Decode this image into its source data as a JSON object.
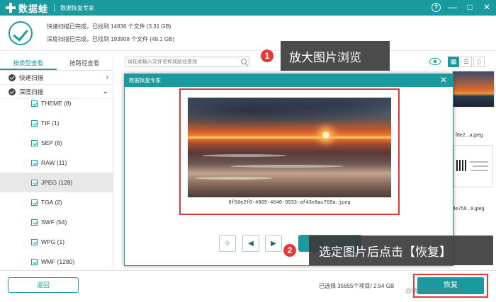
{
  "titlebar": {
    "app_name": "数据蛙",
    "subtitle": "数据恢复专家",
    "help": "?",
    "minimize": "—",
    "maximize": "□",
    "close": "✕"
  },
  "status": {
    "quick_scan": "快速扫描已完成，已找到   14836 个文件 (3.31 GB)",
    "deep_scan": "深度扫描已完成，已找到   193908 个文件 (49.1 GB)"
  },
  "left_panel": {
    "tabs": [
      "按类型查看",
      "按路径查看"
    ],
    "quick_scan_label": "快速扫描",
    "deep_scan_label": "深度扫描",
    "file_types": [
      {
        "label": "THEME (8)"
      },
      {
        "label": "TIF (1)"
      },
      {
        "label": "SEP (8)"
      },
      {
        "label": "RAW (11)"
      },
      {
        "label": "JPEG (128)",
        "selected": true
      },
      {
        "label": "TGA (2)"
      },
      {
        "label": "SWF (54)"
      },
      {
        "label": "WPG (1)"
      },
      {
        "label": "WMF (1280)"
      }
    ]
  },
  "toolbar": {
    "search_placeholder": "请在此输入文件名称或路径查找"
  },
  "background": {
    "thumb1_caption": "f8e2...a.jpeg",
    "thumb2_caption": "4e759...9.jpeg"
  },
  "dialog": {
    "title": "数据恢复专家",
    "close": "✕",
    "image_filename": "0f56e2f0-4909-4640-9933-af43e8ac769a.jpeg",
    "btn_fit": "⊹",
    "btn_prev": "◀",
    "btn_next": "▶"
  },
  "callouts": [
    {
      "number": "1",
      "text": "放大图片浏览"
    },
    {
      "number": "2",
      "text": "选定图片后点击【恢复】"
    }
  ],
  "bottom": {
    "back": "返回",
    "selected_info": "已选择 35655个项目/ 2.54 GB",
    "recover": "恢复",
    "watermark": "@稀土掘金技术社区"
  },
  "colors": {
    "accent": "#1a9a9e",
    "highlight": "#e03a3a",
    "badge": "#e53935"
  }
}
